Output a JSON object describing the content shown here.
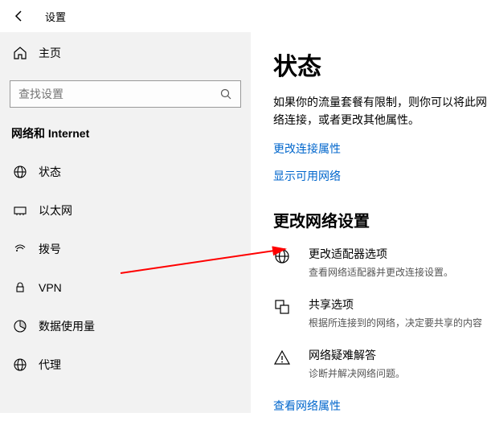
{
  "header": {
    "title": "设置"
  },
  "sidebar": {
    "home_label": "主页",
    "search_placeholder": "查找设置",
    "section_title": "网络和 Internet",
    "items": [
      {
        "label": "状态"
      },
      {
        "label": "以太网"
      },
      {
        "label": "拨号"
      },
      {
        "label": "VPN"
      },
      {
        "label": "数据使用量"
      },
      {
        "label": "代理"
      }
    ]
  },
  "main": {
    "page_title": "状态",
    "description": "如果你的流量套餐有限制，则你可以将此网络连接，或者更改其他属性。",
    "link_change_conn": "更改连接属性",
    "link_show_networks": "显示可用网络",
    "section_title": "更改网络设置",
    "options": [
      {
        "title": "更改适配器选项",
        "sub": "查看网络适配器并更改连接设置。"
      },
      {
        "title": "共享选项",
        "sub": "根据所连接到的网络，决定要共享的内容"
      },
      {
        "title": "网络疑难解答",
        "sub": "诊断并解决网络问题。"
      }
    ],
    "link_view_props": "查看网络属性"
  }
}
